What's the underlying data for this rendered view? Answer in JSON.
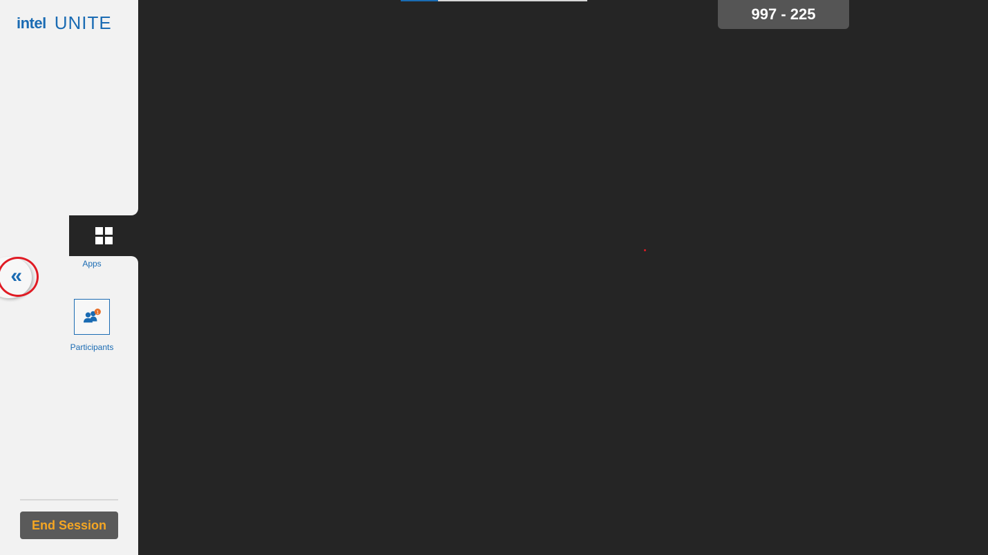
{
  "app": {
    "logo_brand": "intel",
    "logo_product": "UNITE"
  },
  "session": {
    "pin": "997 - 225",
    "progress_fraction": 0.2
  },
  "sidebar": {
    "apps_label": "Apps",
    "participants_label": "Participants",
    "participants_badge": "1",
    "end_session_label": "End Session",
    "collapse_icon": "chevron-double-left-icon",
    "collapse_glyph": "«"
  },
  "colors": {
    "accent": "#1a6bb3",
    "end_session_text": "#f5a623",
    "badge": "#e8702a",
    "highlight": "#e01b24",
    "canvas": "#252525"
  }
}
